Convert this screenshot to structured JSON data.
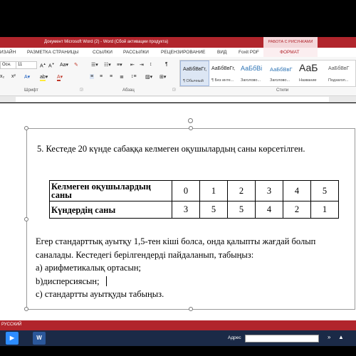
{
  "window": {
    "title": "Документ Microsoft Word (2) - Word (Сбой активации продукта)",
    "contextual_tab_group": "РАБОТА С РИСУНКАМИ"
  },
  "tabs": [
    "ИЗАЙН",
    "РАЗМЕТКА СТРАНИЦЫ",
    "ССЫЛКИ",
    "РАССЫЛКИ",
    "РЕЦЕНЗИРОВАНИЕ",
    "ВИД",
    "Foxit PDF",
    "ФОРМАТ"
  ],
  "ribbon": {
    "font_name": "Осн.",
    "font_size": "11",
    "groups": {
      "font": "Шрифт",
      "paragraph": "Абзац",
      "styles": "Стили"
    },
    "styles": [
      {
        "sample": "АаБбВвГг,",
        "name": "¶ Обычный"
      },
      {
        "sample": "АаБбВвГг,",
        "name": "¶ Без инте..."
      },
      {
        "sample": "АаБбВі",
        "name": "Заголово..."
      },
      {
        "sample": "АаБбВвГ",
        "name": "Заголово..."
      },
      {
        "sample": "АаБ",
        "name": "Название"
      },
      {
        "sample": "АаБбВвГ",
        "name": "Подзагол..."
      }
    ]
  },
  "document": {
    "heading": "5. Кестеде 20 күнде  сабаққа келмеген оқушылардың саны көрсетілген.",
    "table": {
      "rows": [
        {
          "label_line1": "Келмеген оқушылардың",
          "label_line2": "саны",
          "values": [
            "0",
            "1",
            "2",
            "3",
            "4",
            "5"
          ]
        },
        {
          "label_line1": "Күндердің саны",
          "label_line2": "",
          "values": [
            "3",
            "5",
            "5",
            "4",
            "2",
            "1"
          ]
        }
      ]
    },
    "paragraph_line1": "Егер стандарттық ауытқу 1,5-тен кіші болса, онда қалыпты жағдай болып",
    "paragraph_line2": "саналады. Кестедегі берілгендерді пайдаланып, табыңыз:",
    "item_a": "а) арифметикалық ортасын;",
    "item_b": "b)дисперсиясын;",
    "item_c": "с) стандартты ауытқуды табыңыз."
  },
  "statusbar": {
    "language": "РУССКИЙ"
  },
  "taskbar": {
    "address_label": "Адрес",
    "word_icon_letter": "W"
  },
  "colors": {
    "accent": "#b1252c",
    "taskbar": "#1b2a47"
  }
}
